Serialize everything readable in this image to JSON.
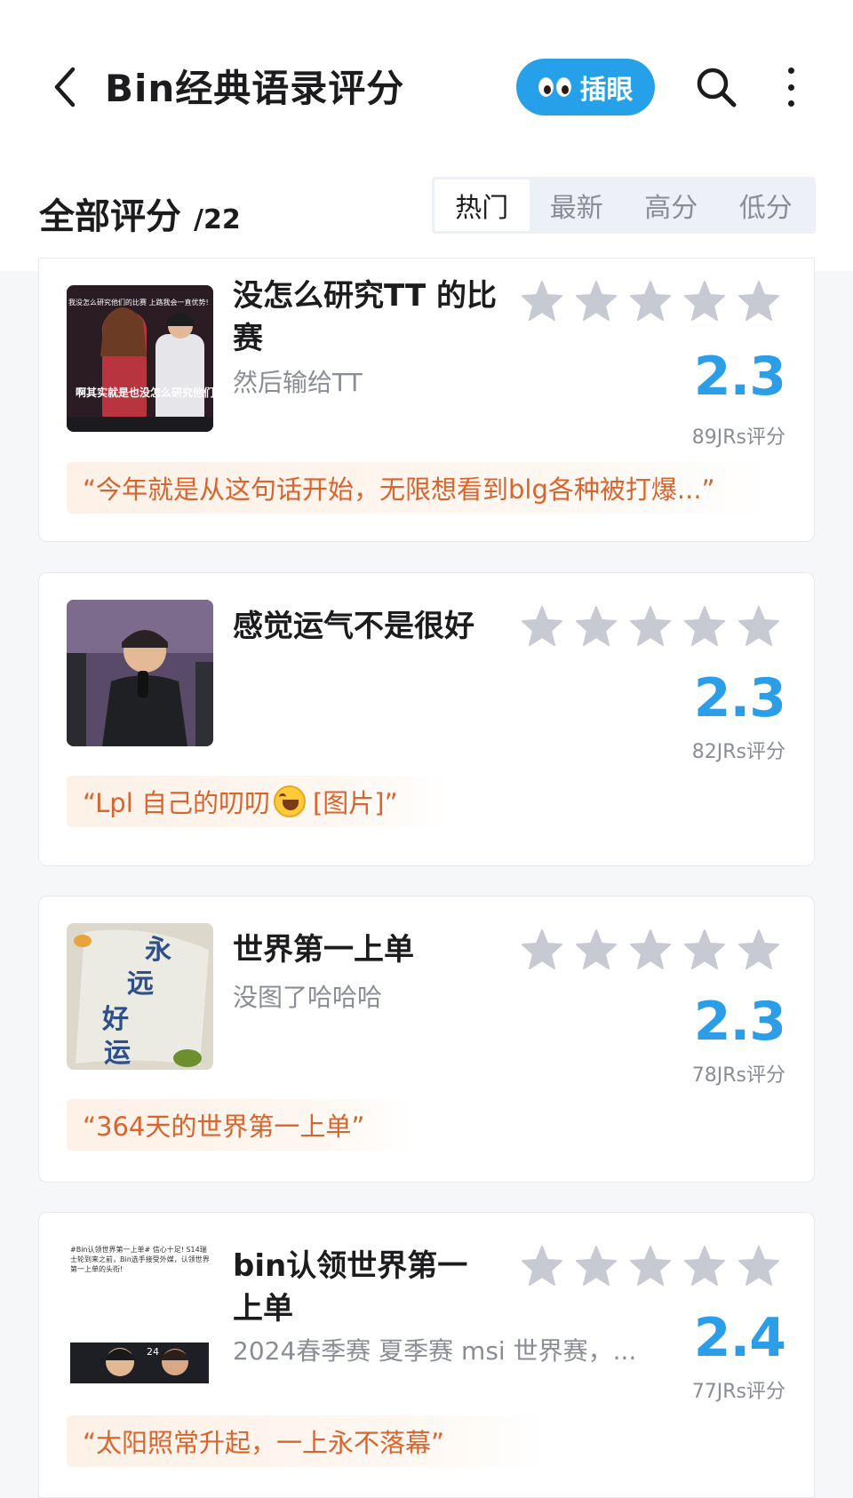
{
  "header": {
    "title": "Bin经典语录评分",
    "peek_label": "插眼",
    "back_icon": "chevron-left-icon",
    "search_icon": "search-icon",
    "more_icon": "more-vertical-icon"
  },
  "list_header": {
    "label": "全部评分",
    "count": "/22",
    "sort_tabs": [
      "热门",
      "最新",
      "高分",
      "低分"
    ],
    "active_tab": "热门"
  },
  "colors": {
    "accent": "#2c9ee8",
    "quote_text": "#d8642e",
    "star_gray": "#c7c9d3"
  },
  "cards": [
    {
      "title": "没怎么研究TT 的比赛",
      "subtitle": "然后输给TT",
      "rating": 0,
      "score": "2.3",
      "votes": "89JRs评分",
      "quote": "“今年就是从这句话开始，无限想看到blg各种被打爆...”",
      "thumb_caption": "我没怎么研究他们的比赛 上路我会一直优势!",
      "thumb_subtitle": "啊其实就是也没怎么研究他们"
    },
    {
      "title": "感觉运气不是很好",
      "subtitle": "",
      "rating": 0,
      "score": "2.3",
      "votes": "82JRs评分",
      "quote_prefix": "“Lpl 自己的叨叨",
      "quote_suffix": "[图片]”"
    },
    {
      "title": "世界第一上单",
      "subtitle": "没图了哈哈哈",
      "rating": 0,
      "score": "2.3",
      "votes": "78JRs评分",
      "quote": "“364天的世界第一上单”"
    },
    {
      "title": "bin认领世界第一上单",
      "subtitle": "2024春季赛 夏季赛 msi 世界赛，...",
      "rating": 0,
      "score": "2.4",
      "votes": "77JRs评分",
      "quote": "“太阳照常升起，一上永不落幕”",
      "thumb_text": "#Bin认领世界第一上单# 信心十足! S14瑞士轮到来之前，Bin选手接受外媒，认领世界第一上单的头衔!"
    }
  ]
}
